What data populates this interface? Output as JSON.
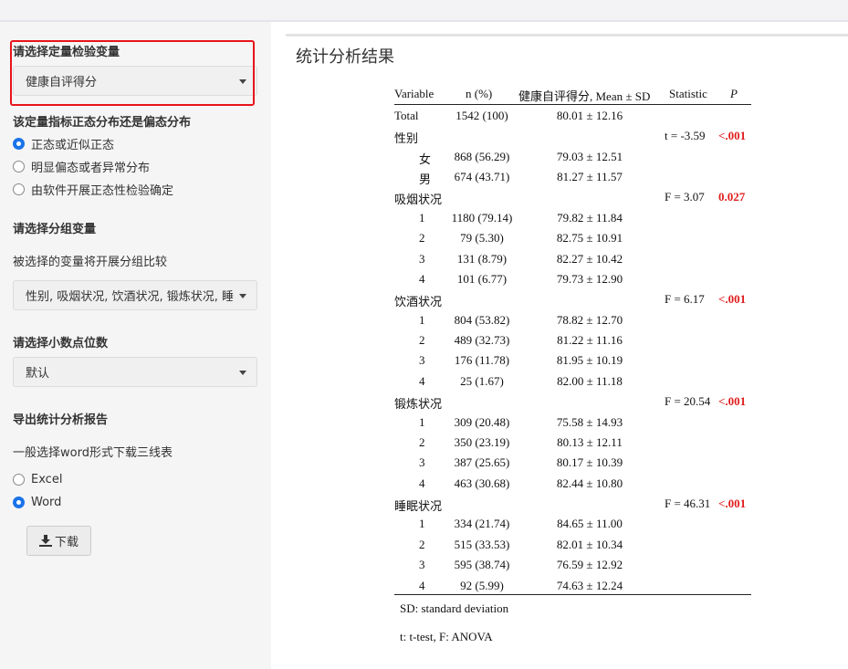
{
  "sidebar": {
    "quant_var_label": "请选择定量检验变量",
    "quant_var_selected": "健康自评得分",
    "distribution_label": "该定量指标正态分布还是偏态分布",
    "distribution_options": [
      "正态或近似正态",
      "明显偏态或者异常分布",
      "由软件开展正态性检验确定"
    ],
    "distribution_selected_index": 0,
    "group_var_label": "请选择分组变量",
    "group_var_hint": "被选择的变量将开展分组比较",
    "group_var_selected": "性别, 吸烟状况, 饮酒状况, 锻炼状况, 睡",
    "decimal_label": "请选择小数点位数",
    "decimal_selected": "默认",
    "export_label": "导出统计分析报告",
    "export_hint": "一般选择word形式下载三线表",
    "export_options": [
      "Excel",
      "Word"
    ],
    "export_selected_index": 1,
    "download_label": "下载",
    "highlight_color": "#e8141b"
  },
  "main": {
    "title": "统计分析结果",
    "table": {
      "headers": [
        "Variable",
        "n (%)",
        "健康自评得分, Mean ± SD",
        "Statistic",
        "P"
      ],
      "rows": [
        {
          "variable": "Total",
          "n": "1542 (100)",
          "mean": "80.01 ± 12.16",
          "stat": "",
          "p": "",
          "kind": "total"
        },
        {
          "variable": "性别",
          "n": "",
          "mean": "",
          "stat": "t = -3.59",
          "p": "<.001",
          "kind": "group"
        },
        {
          "variable": "女",
          "n": "868 (56.29)",
          "mean": "79.03 ± 12.51",
          "stat": "",
          "p": "",
          "kind": "level"
        },
        {
          "variable": "男",
          "n": "674 (43.71)",
          "mean": "81.27 ± 11.57",
          "stat": "",
          "p": "",
          "kind": "level"
        },
        {
          "variable": "吸烟状况",
          "n": "",
          "mean": "",
          "stat": "F = 3.07",
          "p": "0.027",
          "kind": "group"
        },
        {
          "variable": "1",
          "n": "1180 (79.14)",
          "mean": "79.82 ± 11.84",
          "stat": "",
          "p": "",
          "kind": "level"
        },
        {
          "variable": "2",
          "n": "79 (5.30)",
          "mean": "82.75 ± 10.91",
          "stat": "",
          "p": "",
          "kind": "level"
        },
        {
          "variable": "3",
          "n": "131 (8.79)",
          "mean": "82.27 ± 10.42",
          "stat": "",
          "p": "",
          "kind": "level"
        },
        {
          "variable": "4",
          "n": "101 (6.77)",
          "mean": "79.73 ± 12.90",
          "stat": "",
          "p": "",
          "kind": "level"
        },
        {
          "variable": "饮酒状况",
          "n": "",
          "mean": "",
          "stat": "F = 6.17",
          "p": "<.001",
          "kind": "group"
        },
        {
          "variable": "1",
          "n": "804 (53.82)",
          "mean": "78.82 ± 12.70",
          "stat": "",
          "p": "",
          "kind": "level"
        },
        {
          "variable": "2",
          "n": "489 (32.73)",
          "mean": "81.22 ± 11.16",
          "stat": "",
          "p": "",
          "kind": "level"
        },
        {
          "variable": "3",
          "n": "176 (11.78)",
          "mean": "81.95 ± 10.19",
          "stat": "",
          "p": "",
          "kind": "level"
        },
        {
          "variable": "4",
          "n": "25 (1.67)",
          "mean": "82.00 ± 11.18",
          "stat": "",
          "p": "",
          "kind": "level"
        },
        {
          "variable": "锻炼状况",
          "n": "",
          "mean": "",
          "stat": "F = 20.54",
          "p": "<.001",
          "kind": "group"
        },
        {
          "variable": "1",
          "n": "309 (20.48)",
          "mean": "75.58 ± 14.93",
          "stat": "",
          "p": "",
          "kind": "level"
        },
        {
          "variable": "2",
          "n": "350 (23.19)",
          "mean": "80.13 ± 12.11",
          "stat": "",
          "p": "",
          "kind": "level"
        },
        {
          "variable": "3",
          "n": "387 (25.65)",
          "mean": "80.17 ± 10.39",
          "stat": "",
          "p": "",
          "kind": "level"
        },
        {
          "variable": "4",
          "n": "463 (30.68)",
          "mean": "82.44 ± 10.80",
          "stat": "",
          "p": "",
          "kind": "level"
        },
        {
          "variable": "睡眠状况",
          "n": "",
          "mean": "",
          "stat": "F = 46.31",
          "p": "<.001",
          "kind": "group"
        },
        {
          "variable": "1",
          "n": "334 (21.74)",
          "mean": "84.65 ± 11.00",
          "stat": "",
          "p": "",
          "kind": "level"
        },
        {
          "variable": "2",
          "n": "515 (33.53)",
          "mean": "82.01 ± 10.34",
          "stat": "",
          "p": "",
          "kind": "level"
        },
        {
          "variable": "3",
          "n": "595 (38.74)",
          "mean": "76.59 ± 12.92",
          "stat": "",
          "p": "",
          "kind": "level"
        },
        {
          "variable": "4",
          "n": "92 (5.99)",
          "mean": "74.63 ± 12.24",
          "stat": "",
          "p": "",
          "kind": "level"
        }
      ]
    },
    "footnote1": "SD: standard deviation",
    "footnote2": "t: t-test, F: ANOVA",
    "significant_color": "#e01e1e"
  }
}
